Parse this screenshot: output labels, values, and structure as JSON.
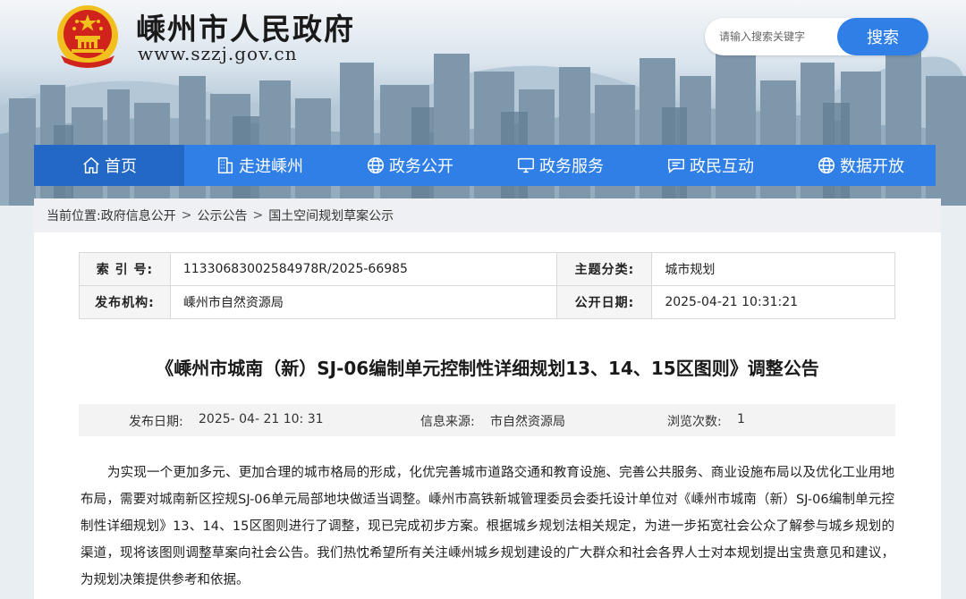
{
  "site": {
    "title": "嵊州市人民政府",
    "url": "www.szzj.gov.cn"
  },
  "search": {
    "placeholder": "请输入搜索关键字",
    "button_label": "搜索"
  },
  "nav": {
    "items": [
      {
        "label": "首页",
        "icon": "home-icon"
      },
      {
        "label": "走进嵊州",
        "icon": "building-icon"
      },
      {
        "label": "政务公开",
        "icon": "globe-icon"
      },
      {
        "label": "政务服务",
        "icon": "monitor-icon"
      },
      {
        "label": "政民互动",
        "icon": "chat-icon"
      },
      {
        "label": "数据开放",
        "icon": "globe-icon"
      }
    ]
  },
  "breadcrumb": {
    "prefix": "当前位置:",
    "items": [
      "政府信息公开",
      "公示公告",
      "国土空间规划草案公示"
    ],
    "separator": ">"
  },
  "meta": {
    "index_label": "索 引 号:",
    "index_value": "11330683002584978R/2025-66985",
    "category_label": "主题分类:",
    "category_value": "城市规划",
    "publisher_label": "发布机构:",
    "publisher_value": "嵊州市自然资源局",
    "open_date_label": "公开日期:",
    "open_date_value": "2025-04-21 10:31:21"
  },
  "article": {
    "title": "《嵊州市城南（新）SJ-06编制单元控制性详细规划13、14、15区图则》调整公告",
    "publish_date_label": "发布日期:",
    "publish_date_value": "2025- 04- 21 10: 31",
    "source_label": "信息来源:",
    "source_value": "市自然资源局",
    "views_label": "浏览次数:",
    "views_value": "1",
    "body": "为实现一个更加多元、更加合理的城市格局的形成，化优完善城市道路交通和教育设施、完善公共服务、商业设施布局以及优化工业用地布局，需要对城南新区控规SJ-06单元局部地块做适当调整。嵊州市高铁新城管理委员会委托设计单位对《嵊州市城南（新）SJ-06编制单元控制性详细规划》13、14、15区图则进行了调整，现已完成初步方案。根据城乡规划法相关规定，为进一步拓宽社会公众了解参与城乡规划的渠道，现将该图则调整草案向社会公告。我们热忱希望所有关注嵊州城乡规划建设的广大群众和社会各界人士对本规划提出宝贵意见和建议，为规划决策提供参考和依据。"
  },
  "colors": {
    "nav_bg": "#2f7fe6",
    "nav_active": "#2368c4",
    "search_button": "#2f7fe6",
    "emblem_red": "#d0231b",
    "emblem_gold": "#f2c01e"
  }
}
